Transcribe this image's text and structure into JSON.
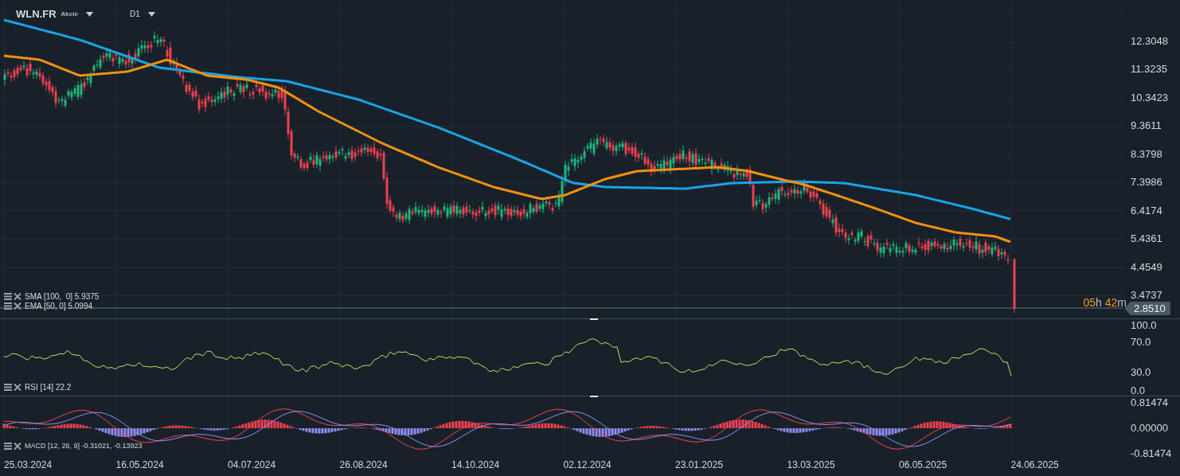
{
  "header": {
    "symbol": "WLN.FR",
    "type": "Akcie",
    "timeframe": "D1"
  },
  "price_axis": [
    "12.3048",
    "11.3235",
    "10.3423",
    "9.3611",
    "8.3798",
    "7.3986",
    "6.4174",
    "5.4361",
    "4.4549",
    "3.4737"
  ],
  "last_price": "2.8510",
  "countdown": {
    "hours": "05",
    "hours_unit": "h",
    "minutes": "42",
    "minutes_unit": "m"
  },
  "main_legends": [
    {
      "label": "SMA [100,  0] 5.9375",
      "color": "#1aa3e8"
    },
    {
      "label": "EMA [50, 0] 5.0994",
      "color": "#f5900f"
    }
  ],
  "rsi_legend": "RSI [14] 22.2",
  "rsi_axis": [
    "100.0",
    "70.0",
    "30.0",
    "0.0"
  ],
  "macd_legend": "MACD [12, 26, 9] -0.31021, -0.13923",
  "macd_axis": [
    "0.81474",
    "0.00000",
    "-0.81474"
  ],
  "dates": [
    "25.03.2024",
    "16.05.2024",
    "04.07.2024",
    "26.08.2024",
    "14.10.2024",
    "02.12.2024",
    "23.01.2025",
    "13.03.2025",
    "06.05.2025",
    "24.06.2025"
  ]
}
